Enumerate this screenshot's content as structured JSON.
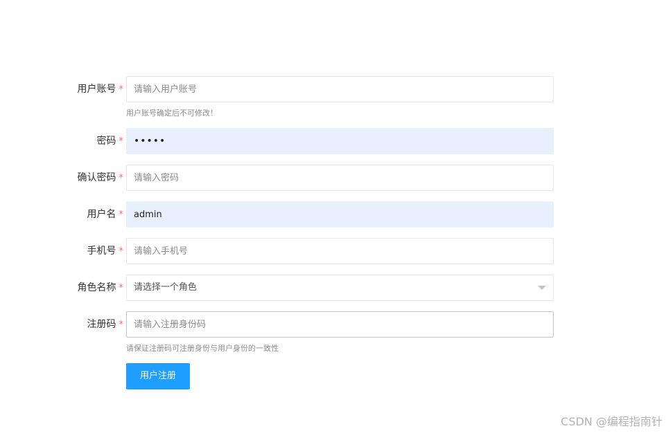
{
  "form": {
    "account": {
      "label": "用户账号",
      "required_mark": "*",
      "placeholder": "请输入用户账号",
      "value": "",
      "hint": "用户账号确定后不可修改！"
    },
    "password": {
      "label": "密码",
      "required_mark": "*",
      "value": "•••••"
    },
    "confirm_password": {
      "label": "确认密码",
      "required_mark": "*",
      "placeholder": "请输入密码",
      "value": ""
    },
    "username": {
      "label": "用户名",
      "required_mark": "*",
      "value": "admin"
    },
    "phone": {
      "label": "手机号",
      "required_mark": "*",
      "placeholder": "请输入手机号",
      "value": ""
    },
    "role": {
      "label": "角色名称",
      "required_mark": "*",
      "selected_text": "请选择一个角色",
      "icon": "chevron-down-icon"
    },
    "reg_code": {
      "label": "注册码",
      "required_mark": "*",
      "placeholder": "请输入注册身份码",
      "value": "",
      "hint": "请保证注册码可注册身份与用户身份的一致性"
    },
    "submit_label": "用户注册"
  },
  "watermark": "CSDN @编程指南针",
  "colors": {
    "primary_button": "#1e9fff",
    "required_mark": "#f56c6c",
    "autofill_background": "#e8f0fe"
  }
}
